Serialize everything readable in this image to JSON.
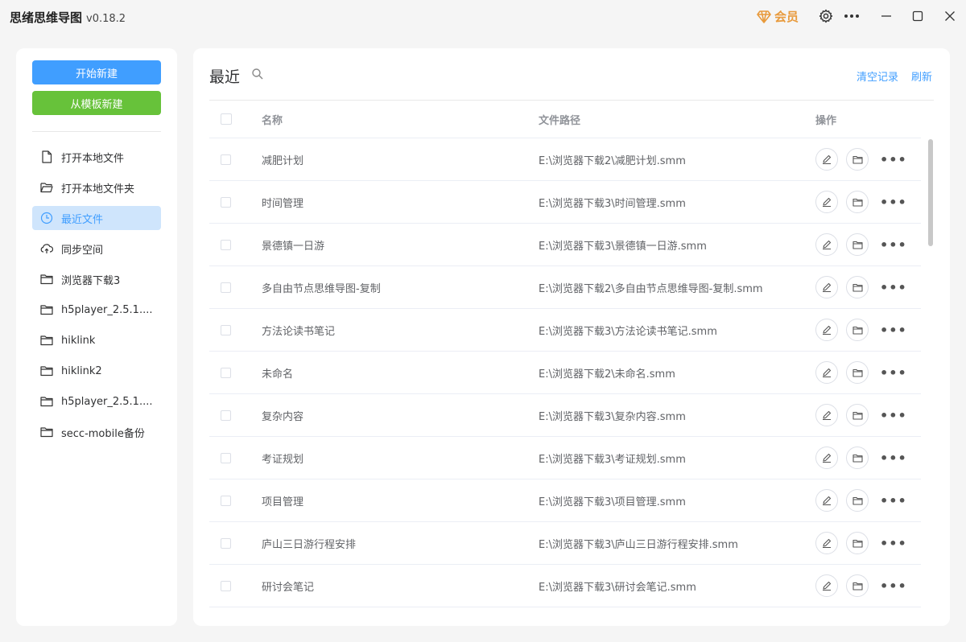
{
  "app": {
    "title": "思绪思维导图",
    "version": "v0.18.2",
    "vip_label": "会员"
  },
  "colors": {
    "primary": "#409eff",
    "success": "#67c23a",
    "vip": "#e89a3c"
  },
  "sidebar": {
    "new_button": "开始新建",
    "template_button": "从模板新建",
    "items": [
      {
        "label": "打开本地文件",
        "icon": "file-icon"
      },
      {
        "label": "打开本地文件夹",
        "icon": "folder-open-icon"
      },
      {
        "label": "最近文件",
        "icon": "clock-icon",
        "active": true
      },
      {
        "label": "同步空间",
        "icon": "cloud-sync-icon"
      },
      {
        "label": "浏览器下载3",
        "icon": "folder-icon"
      },
      {
        "label": "h5player_2.5.1....",
        "icon": "folder-icon"
      },
      {
        "label": "hiklink",
        "icon": "folder-icon"
      },
      {
        "label": "hiklink2",
        "icon": "folder-icon"
      },
      {
        "label": "h5player_2.5.1....",
        "icon": "folder-icon"
      },
      {
        "label": "secc-mobile备份",
        "icon": "folder-icon"
      }
    ]
  },
  "main": {
    "title": "最近",
    "clear_label": "清空记录",
    "refresh_label": "刷新",
    "columns": {
      "name": "名称",
      "path": "文件路径",
      "ops": "操作"
    },
    "rows": [
      {
        "name": "减肥计划",
        "path": "E:\\浏览器下载2\\减肥计划.smm"
      },
      {
        "name": "时间管理",
        "path": "E:\\浏览器下载3\\时间管理.smm"
      },
      {
        "name": "景德镇一日游",
        "path": "E:\\浏览器下载3\\景德镇一日游.smm"
      },
      {
        "name": "多自由节点思维导图-复制",
        "path": "E:\\浏览器下载2\\多自由节点思维导图-复制.smm"
      },
      {
        "name": "方法论读书笔记",
        "path": "E:\\浏览器下载3\\方法论读书笔记.smm"
      },
      {
        "name": "未命名",
        "path": "E:\\浏览器下载2\\未命名.smm"
      },
      {
        "name": "复杂内容",
        "path": "E:\\浏览器下载3\\复杂内容.smm"
      },
      {
        "name": "考证规划",
        "path": "E:\\浏览器下载3\\考证规划.smm"
      },
      {
        "name": "项目管理",
        "path": "E:\\浏览器下载3\\项目管理.smm"
      },
      {
        "name": "庐山三日游行程安排",
        "path": "E:\\浏览器下载3\\庐山三日游行程安排.smm"
      },
      {
        "name": "研讨会笔记",
        "path": "E:\\浏览器下载3\\研讨会笔记.smm"
      }
    ]
  }
}
